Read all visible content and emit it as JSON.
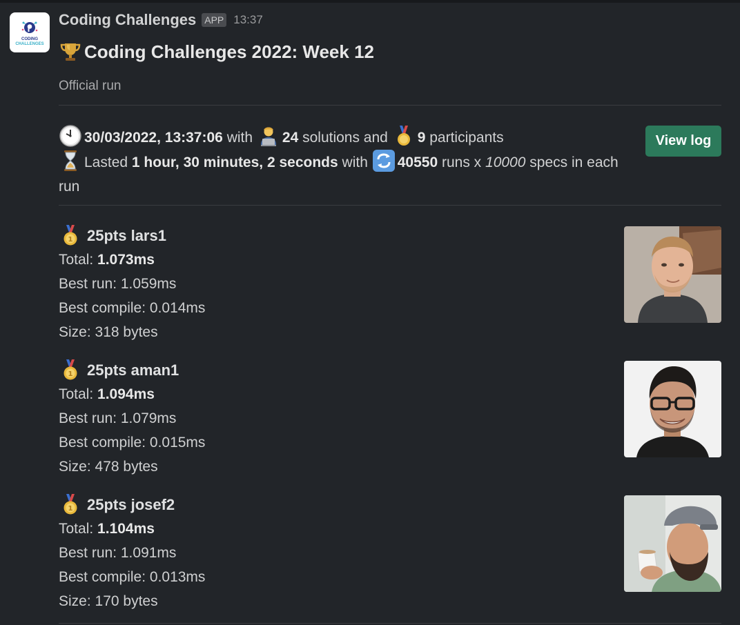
{
  "app": {
    "name": "Coding Challenges",
    "badge": "APP",
    "time": "13:37",
    "avatar_text_line1": "CODING",
    "avatar_text_line2": "CHALLENGES"
  },
  "message": {
    "title": "Coding Challenges 2022: Week 12",
    "title_icon": "trophy-icon",
    "subtitle": "Official run",
    "summary": {
      "datetime": "30/03/2022, 13:37:06",
      "with1": "with",
      "solutions_count": "24",
      "solutions_label": "solutions and",
      "participants_count": "9",
      "participants_label": "participants",
      "lasted_label": "Lasted",
      "duration": "1 hour, 30 minutes, 2 seconds",
      "with2": "with",
      "runs_count": "40550",
      "runs_label": "runs x",
      "specs_count": "10000",
      "specs_label": "specs in each run",
      "icons": [
        "clock-icon",
        "technologist-icon",
        "medal-icon",
        "hourglass-icon",
        "repeat-icon"
      ]
    },
    "view_log_label": "View log"
  },
  "entries": [
    {
      "rank_line": "25pts lars1",
      "total_label": "Total: ",
      "total_value": "1.073ms",
      "best_run": "Best run: 1.059ms",
      "best_compile": "Best compile: 0.014ms",
      "size": "Size: 318 bytes"
    },
    {
      "rank_line": "25pts aman1",
      "total_label": "Total: ",
      "total_value": "1.094ms",
      "best_run": "Best run: 1.079ms",
      "best_compile": "Best compile: 0.015ms",
      "size": "Size: 478 bytes"
    },
    {
      "rank_line": "25pts josef2",
      "total_label": "Total: ",
      "total_value": "1.104ms",
      "best_run": "Best run: 1.091ms",
      "best_compile": "Best compile: 0.013ms",
      "size": "Size: 170 bytes"
    }
  ],
  "colors": {
    "background": "#222529",
    "button": "#2c7a5b",
    "text": "#d1d2d3"
  }
}
